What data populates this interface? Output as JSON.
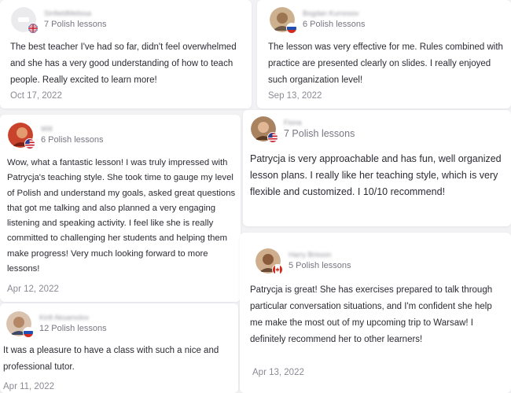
{
  "reviews": [
    {
      "name": "SinfieldMelissa",
      "lessons": "7 Polish lessons",
      "text": "The best teacher I've had so far, didn't feel overwhelmed and she has a very good understanding of how to teach people. Really excited to learn more!",
      "date": "Oct 17, 2022",
      "flag_icon": "uk-flag-icon",
      "avatar_color": "#e9e9ec"
    },
    {
      "name": "Bogdan Kurnosov",
      "lessons": "6 Polish lessons",
      "text": "The lesson was very effective for me. Rules combined with practice are presented clearly on slides. I really enjoyed such organization level!",
      "date": "Sep 13, 2022",
      "flag_icon": "russia-flag-icon",
      "avatar_color": "#c9a27a"
    },
    {
      "name": "Will",
      "lessons": "6 Polish lessons",
      "text": "Wow, what a fantastic lesson! I was truly impressed with Patrycja's teaching style. She took time to gauge my level of Polish and understand my goals, asked great questions that got me talking and also planned a very engaging listening and speaking activity. I feel like she is really committed to challenging her students and helping them make progress! Very much looking forward to more lessons!",
      "date": "Apr 12, 2022",
      "flag_icon": "usa-flag-icon",
      "avatar_color": "#c8422c"
    },
    {
      "name": "Fiona",
      "lessons": "7 Polish lessons",
      "text": "Patrycja is very approachable and has fun, well organized lesson plans. I really like her teaching style, which is very flexible and customized. I 10/10 recommend!",
      "date": "",
      "flag_icon": "usa-flag-icon",
      "avatar_color": "#9c6b45"
    },
    {
      "name": "Harry Brisson",
      "lessons": "5 Polish lessons",
      "text": "Patrycja is great!  She has exercises prepared to talk through particular conversation situations, and I'm confident she help me make the most out of my upcoming trip to Warsaw!  I definitely recommend her to other learners!",
      "date": "Apr 13, 2022",
      "flag_icon": "canada-flag-icon",
      "avatar_color": "#b88a66"
    },
    {
      "name": "Kirill Aksamolov",
      "lessons": "12 Polish lessons",
      "text": "It was a pleasure to have a class with such a nice and professional tutor.",
      "date": "Apr 11, 2022",
      "flag_icon": "russia-flag-icon",
      "avatar_color": "#c49a7c"
    }
  ]
}
